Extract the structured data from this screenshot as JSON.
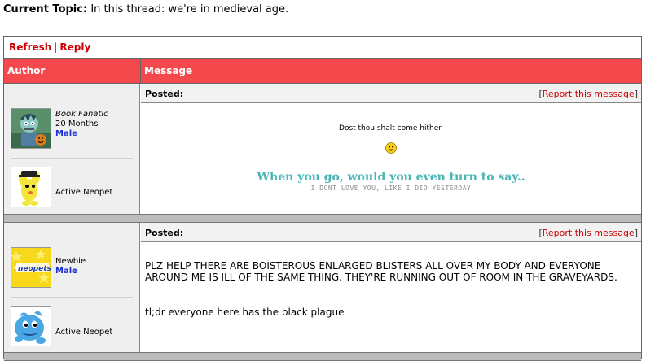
{
  "topic": {
    "label": "Current Topic:",
    "text": "In this thread: we're in medieval age."
  },
  "actions": {
    "refresh": "Refresh",
    "separator": "|",
    "reply": "Reply"
  },
  "table_header": {
    "author": "Author",
    "message": "Message"
  },
  "colors": {
    "header_red": "#f3494d",
    "link_red": "#cc0000",
    "male_blue": "#1b2fd6",
    "fancy_teal": "#4ab5b6"
  },
  "posts": [
    {
      "author_title": "Book Fanatic",
      "age": "20 Months",
      "gender": "Male",
      "avatar_icon": "zombie-avatar-icon",
      "pet_avatar_icon": "yellow-pet-hat-icon",
      "pet_status": "Active Neopet",
      "posted_label": "Posted:",
      "report_open": "[",
      "report_label": "Report this message",
      "report_close": "]",
      "line1": "Dost thou shalt come hither.",
      "emoji_icon": "smiley-icon",
      "line2": "When you go, would you even turn to say..",
      "line3": "I DONT LOVE YOU, LIKE I DID YESTERDAY"
    },
    {
      "author_title": "Newbie",
      "gender": "Male",
      "avatar_icon": "neopets-star-logo-icon",
      "avatar_text": "neopets",
      "pet_avatar_icon": "blue-pet-icon",
      "pet_status": "Active Neopet",
      "posted_label": "Posted:",
      "report_open": "[",
      "report_label": "Report this message",
      "report_close": "]",
      "body1": "PLZ HELP THERE ARE BOISTEROUS ENLARGED BLISTERS ALL OVER MY BODY AND EVERYONE AROUND ME IS ILL OF THE SAME THING. THEY'RE RUNNING OUT OF ROOM IN THE GRAVEYARDS.",
      "body2": "tl;dr everyone here has the black plague"
    }
  ]
}
